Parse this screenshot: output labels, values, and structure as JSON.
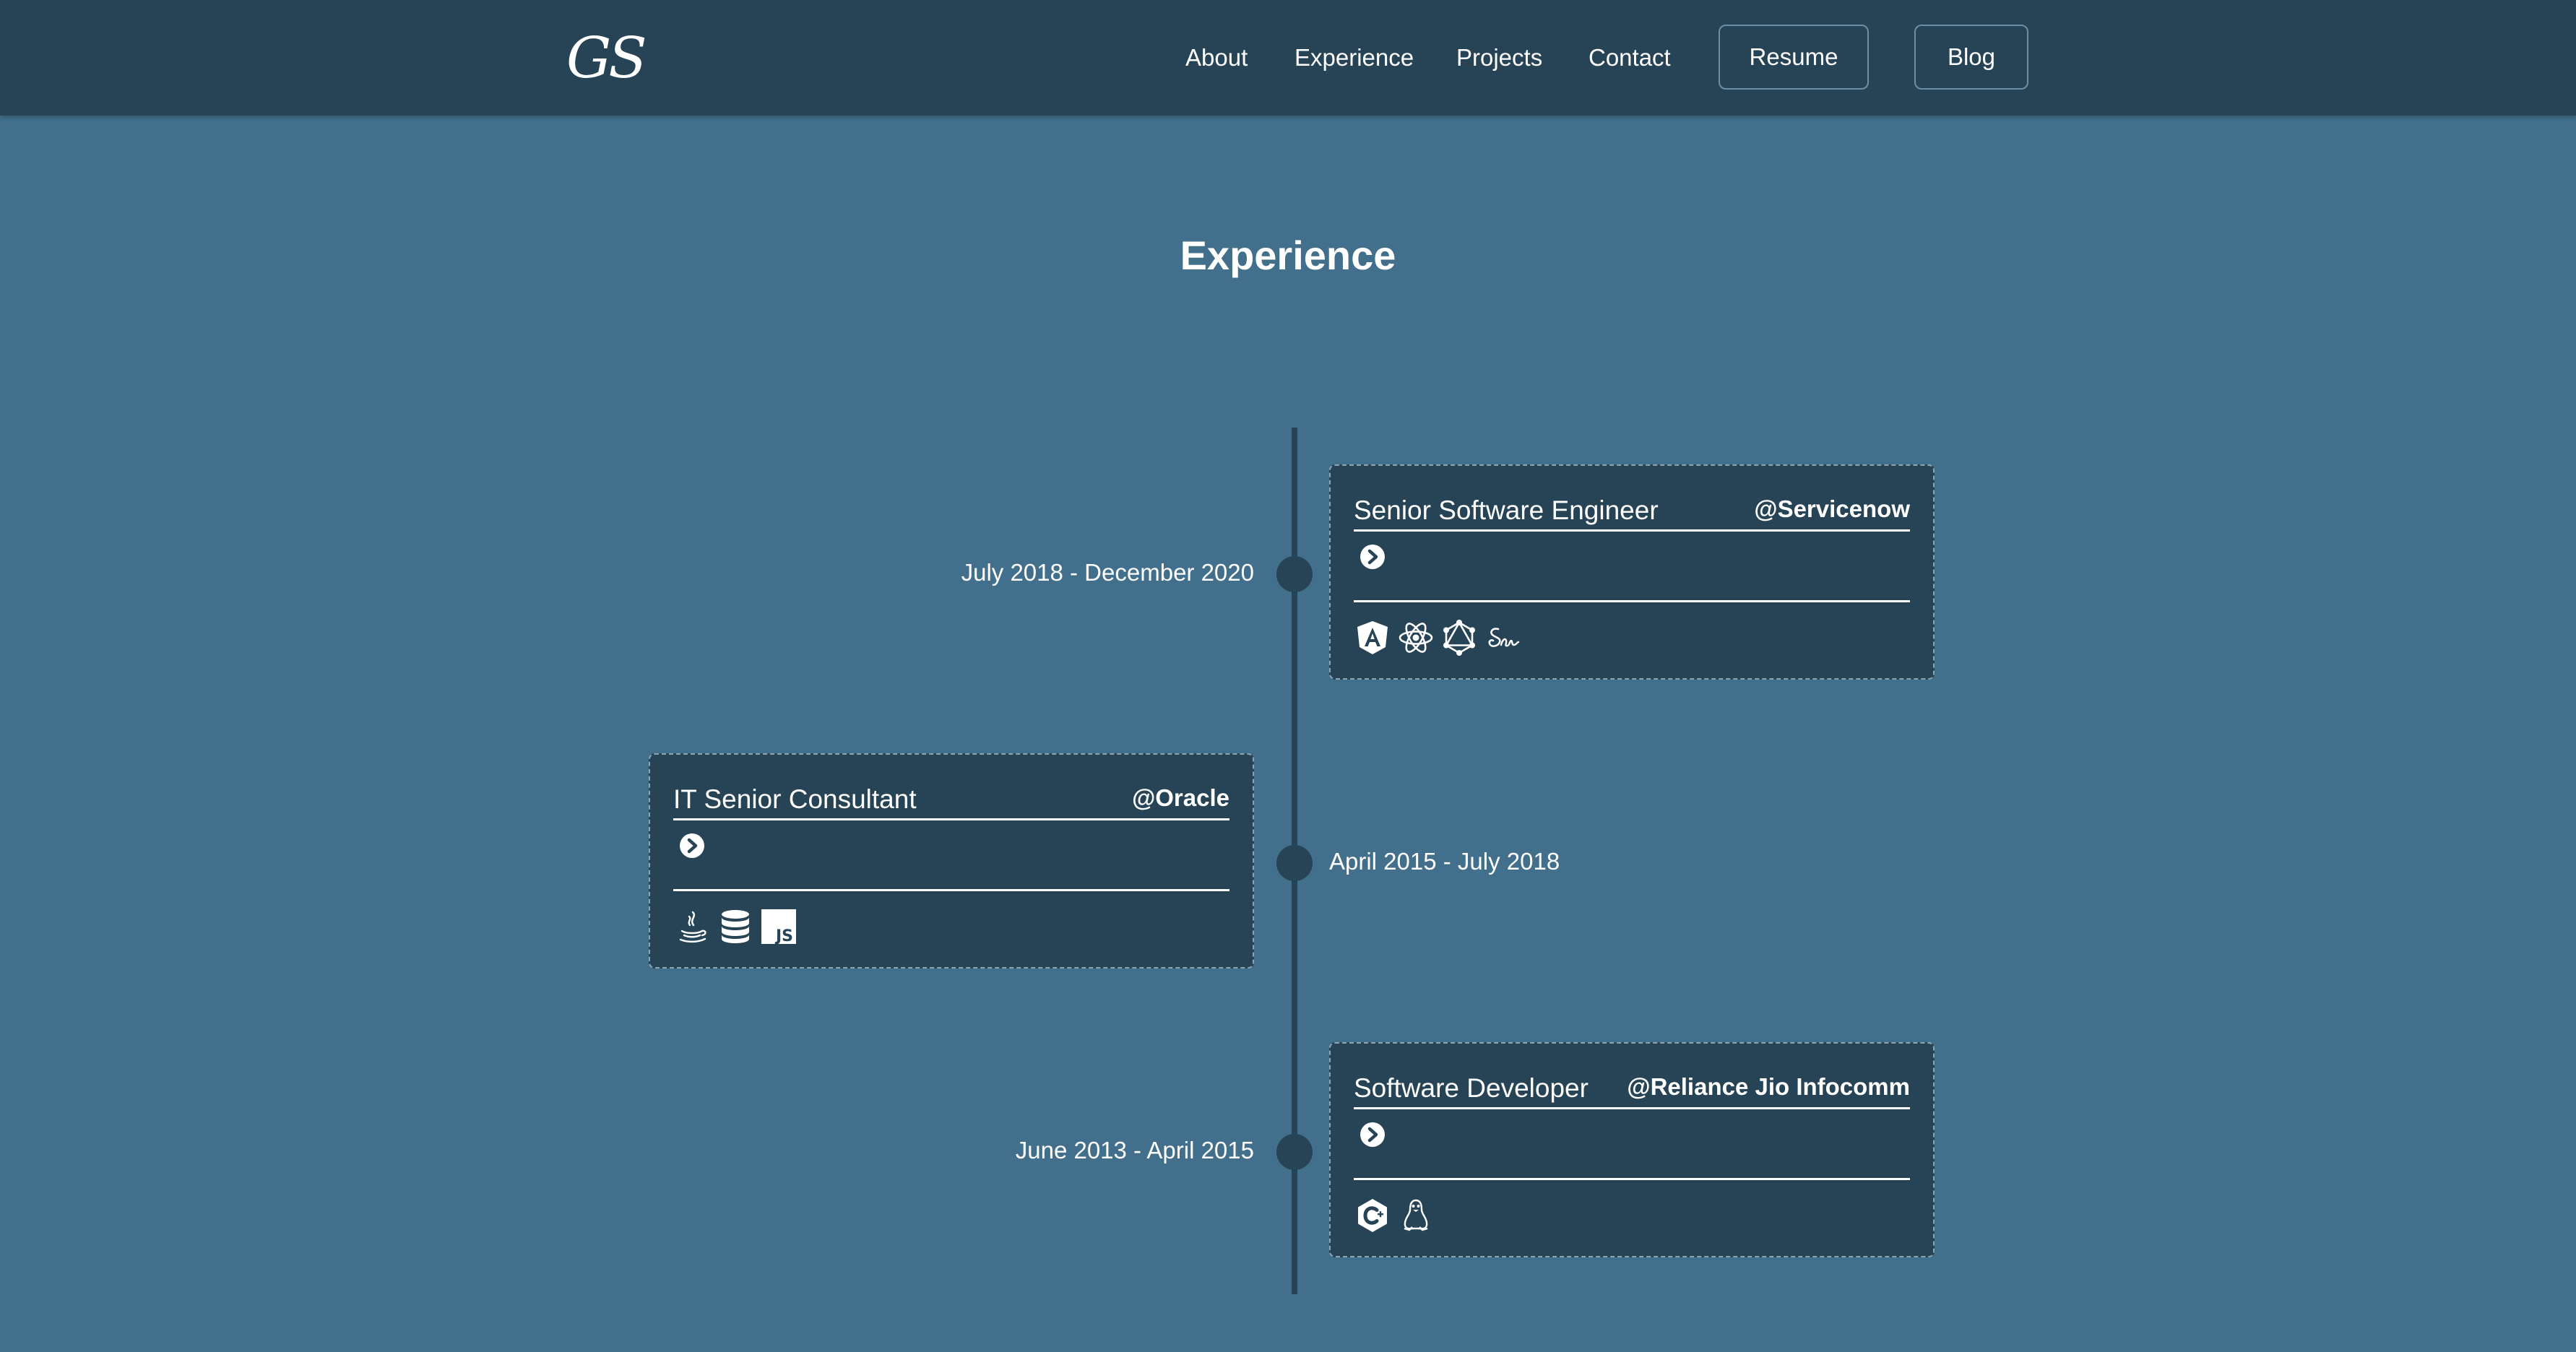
{
  "header": {
    "logo_text": "GS",
    "nav": [
      "About",
      "Experience",
      "Projects",
      "Contact"
    ],
    "resume_label": "Resume",
    "blog_label": "Blog"
  },
  "section": {
    "title": "Experience"
  },
  "experiences": [
    {
      "title": "Senior Software Engineer",
      "company": "@Servicenow",
      "dates": "July 2018 - December 2020",
      "icons": [
        "angular-icon",
        "react-icon",
        "graphql-icon",
        "sass-icon"
      ]
    },
    {
      "title": "IT Senior Consultant",
      "company": "@Oracle",
      "dates": "April 2015 - July 2018",
      "icons": [
        "java-icon",
        "database-icon",
        "javascript-icon"
      ]
    },
    {
      "title": "Software Developer",
      "company": "@Reliance Jio Infocomm",
      "dates": "June 2013 - April 2015",
      "icons": [
        "c-plus-plus-icon",
        "linux-icon"
      ]
    }
  ],
  "colors": {
    "page_bg": "#426f8c",
    "nav_bg": "#264455",
    "card_bg": "#264455",
    "text": "#ffffff"
  }
}
